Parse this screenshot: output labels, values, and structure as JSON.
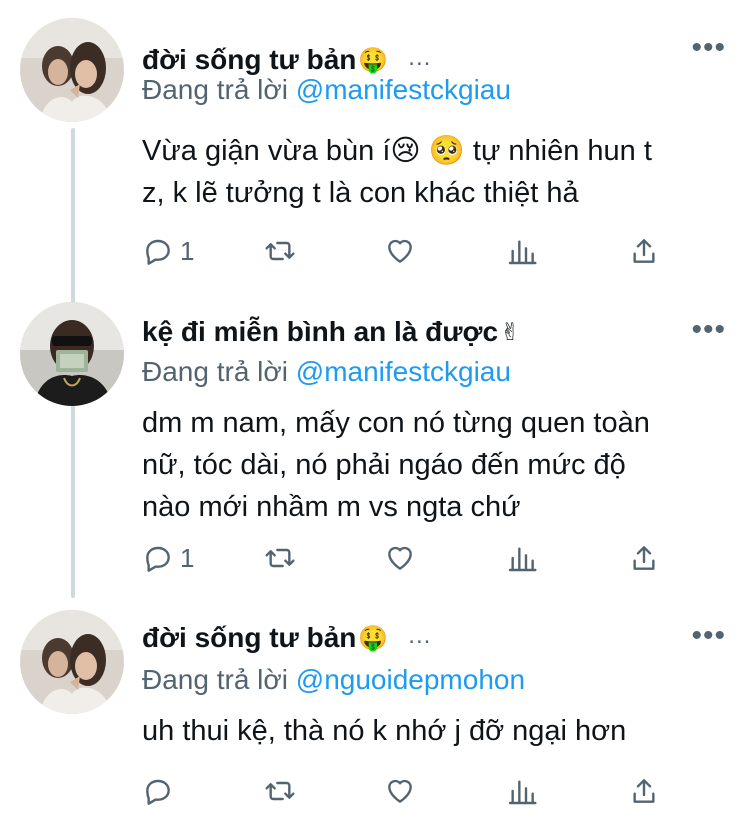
{
  "tweets": [
    {
      "name": "đời sống tư bản",
      "name_emoji": "🤑",
      "dots": "...",
      "reply_prefix": "Đang trả lời",
      "reply_handle": "@manifestckgiau",
      "text_line1": "Vừa giận vừa bùn í😢 🥺  tự nhiên hun t",
      "text_line2": "z, k lẽ tưởng t là con khác thiệt hả",
      "reply_count": "1"
    },
    {
      "name": "kệ đi miễn bình an là được",
      "name_emoji": "✌",
      "reply_prefix": "Đang trả lời",
      "reply_handle": "@manifestckgiau",
      "text_line1": "dm m nam, mấy con nó từng quen toàn",
      "text_line2": "nữ, tóc dài, nó phải ngáo đến mức độ",
      "text_line3": "nào mới nhầm m vs ngta chứ",
      "reply_count": "1"
    },
    {
      "name": "đời sống tư bản",
      "name_emoji": "🤑",
      "dots": "...",
      "reply_prefix": "Đang trả lời",
      "reply_handle": "@nguoidepmohon",
      "text_line1": "uh thui kệ, thà nó k nhớ j đỡ ngại hơn",
      "reply_count": ""
    }
  ],
  "icons": {
    "reply": "reply-icon",
    "retweet": "retweet-icon",
    "like": "heart-icon",
    "views": "analytics-icon",
    "share": "share-icon",
    "more": "more-icon"
  },
  "more_glyph": "•••",
  "colors": {
    "text": "#0f1419",
    "secondary": "#536471",
    "link": "#1d9bf0",
    "thread_line": "#cfd9de"
  }
}
